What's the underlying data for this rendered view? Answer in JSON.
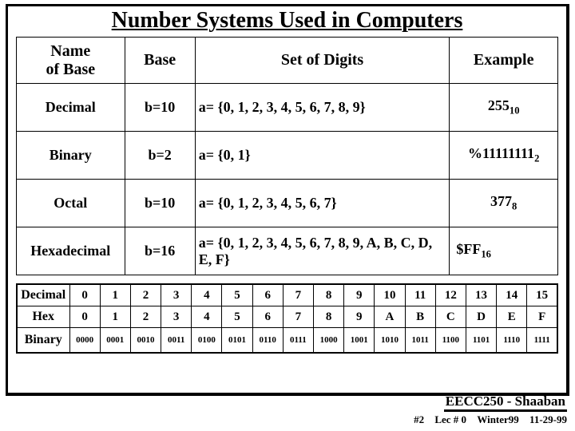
{
  "title": "Number Systems Used in Computers",
  "headers": {
    "name": "Name\nof Base",
    "base": "Base",
    "digits": "Set of Digits",
    "example": "Example"
  },
  "rows": [
    {
      "name": "Decimal",
      "base": "b=10",
      "digits": "a= {0, 1, 2, 3, 4, 5, 6, 7, 8, 9}",
      "exPrefix": "255",
      "exSub": "10"
    },
    {
      "name": "Binary",
      "base": "b=2",
      "digits": "a= {0, 1}",
      "exPrefix": "%11111111",
      "exSub": "2"
    },
    {
      "name": "Octal",
      "base": "b=10",
      "digits": "a= {0, 1, 2, 3, 4, 5, 6, 7}",
      "exPrefix": "377",
      "exSub": "8"
    },
    {
      "name": "Hexadecimal",
      "base": "b=16",
      "digits": "a= {0, 1, 2, 3, 4, 5, 6, 7, 8, 9, A, B, C, D, E, F}",
      "exPrefix": "$FF",
      "exSub": "16"
    }
  ],
  "conv": {
    "labels": {
      "dec": "Decimal",
      "hex": "Hex",
      "bin": "Binary"
    },
    "dec": [
      "0",
      "1",
      "2",
      "3",
      "4",
      "5",
      "6",
      "7",
      "8",
      "9",
      "10",
      "11",
      "12",
      "13",
      "14",
      "15"
    ],
    "hex": [
      "0",
      "1",
      "2",
      "3",
      "4",
      "5",
      "6",
      "7",
      "8",
      "9",
      "A",
      "B",
      "C",
      "D",
      "E",
      "F"
    ],
    "bin": [
      "0000",
      "0001",
      "0010",
      "0011",
      "0100",
      "0101",
      "0110",
      "0111",
      "1000",
      "1001",
      "1010",
      "1011",
      "1100",
      "1101",
      "1110",
      "1111"
    ]
  },
  "footer": {
    "course": "EECC250 - Shaaban",
    "slide": "#2",
    "lec": "Lec # 0",
    "term": "Winter99",
    "date": "11-29-99"
  },
  "chart_data": {
    "type": "table",
    "title": "Number Systems Used in Computers",
    "columns": [
      "Name of Base",
      "Base",
      "Set of Digits",
      "Example"
    ],
    "rows": [
      [
        "Decimal",
        "b=10",
        "{0,1,2,3,4,5,6,7,8,9}",
        "255_10"
      ],
      [
        "Binary",
        "b=2",
        "{0,1}",
        "%11111111_2"
      ],
      [
        "Octal",
        "b=10",
        "{0,1,2,3,4,5,6,7}",
        "377_8"
      ],
      [
        "Hexadecimal",
        "b=16",
        "{0,1,2,3,4,5,6,7,8,9,A,B,C,D,E,F}",
        "$FF_16"
      ]
    ],
    "conversion": {
      "decimal": [
        0,
        1,
        2,
        3,
        4,
        5,
        6,
        7,
        8,
        9,
        10,
        11,
        12,
        13,
        14,
        15
      ],
      "hex": [
        "0",
        "1",
        "2",
        "3",
        "4",
        "5",
        "6",
        "7",
        "8",
        "9",
        "A",
        "B",
        "C",
        "D",
        "E",
        "F"
      ],
      "binary": [
        "0000",
        "0001",
        "0010",
        "0011",
        "0100",
        "0101",
        "0110",
        "0111",
        "1000",
        "1001",
        "1010",
        "1011",
        "1100",
        "1101",
        "1110",
        "1111"
      ]
    }
  }
}
